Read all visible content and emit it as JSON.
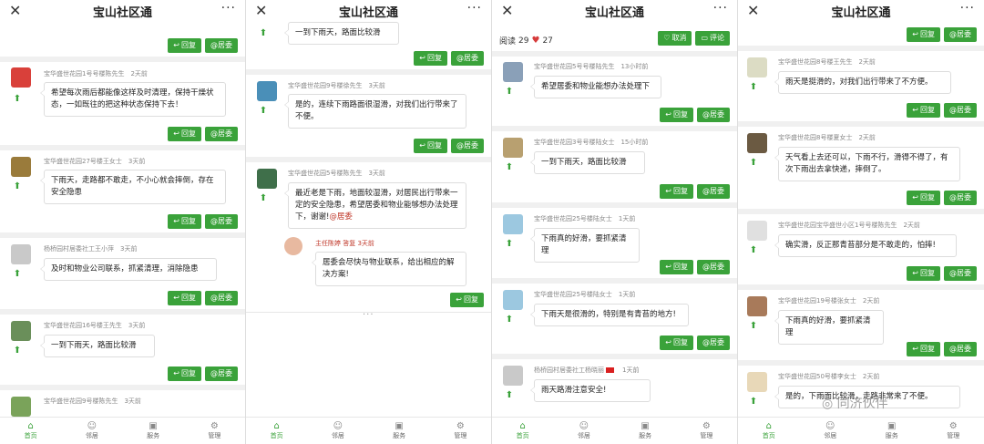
{
  "app": {
    "title": "宝山社区通",
    "close_icon": "✕",
    "more_icon": "···"
  },
  "actions": {
    "reply": "回复",
    "committee": "@居委",
    "cancel": "取消",
    "comment": "评论"
  },
  "stats": {
    "read_label": "阅读",
    "read_count": "29",
    "likes": "27"
  },
  "nav": {
    "home": "首页",
    "neighbors": "邻居",
    "service": "服务",
    "manage": "管理"
  },
  "panel1": {
    "c1": {
      "author": "宝华盛世花园1号号楼陈先生",
      "time": "2天前",
      "text": "希望每次雨后都能像这样及时清理，保持干燥状态，一如既往的把这种状态保持下去！"
    },
    "c2": {
      "author": "宝华盛世花园27号楼王女士",
      "time": "3天前",
      "text": "下雨天，走路都不敢走，不小心就会摔倒，存在安全隐患"
    },
    "c3": {
      "author": "杨桥园村居委社工王小萍",
      "time": "3天前",
      "text": "及时和物业公司联系，抓紧清理，消除隐患"
    },
    "c4": {
      "author": "宝华盛世花园16号楼王先生",
      "time": "3天前",
      "text": "一到下雨天，路面比较滑"
    },
    "c5": {
      "author": "宝华盛世花园9号楼陈先生",
      "time": "3天前"
    }
  },
  "panel2": {
    "c0": {
      "text": "一到下雨天，路面比较滑"
    },
    "c1": {
      "author": "宝华盛世花园9号楼徐先生",
      "time": "3天前",
      "text": "是的，连续下雨路面很湿滑，对我们出行带来了不便。"
    },
    "c2": {
      "author": "宝华盛世花园5号楼陈先生",
      "time": "3天前",
      "text": "最近老是下雨，地面较湿滑，对居民出行带来一定的安全隐患，希望居委和物业能够想办法处理下，谢谢!",
      "mention": "@居委"
    },
    "reply": {
      "author": "主任陈婷 答复 3天前",
      "text": "居委会尽快与物业联系，给出相应的解决方案!"
    }
  },
  "panel3": {
    "c1": {
      "author": "宝华盛世花园5号号楼陆先生",
      "time": "13小时前",
      "text": "希望居委和物业能想办法处理下"
    },
    "c2": {
      "author": "宝华盛世花园3号号楼陆女士",
      "time": "15小时前",
      "text": "一到下雨天，路面比较滑"
    },
    "c3": {
      "author": "宝华盛世花园25号楼陆女士",
      "time": "1天前",
      "text": "下雨真的好滑，要抓紧清理"
    },
    "c4": {
      "author": "宝华盛世花园25号楼陆女士",
      "time": "1天前",
      "text": "下雨天是很滑的，特别是有青苔的地方!"
    },
    "c5": {
      "author": "杨桥园村居委社工杨晓丽",
      "time": "1天前",
      "text": "雨天路滑注意安全!"
    }
  },
  "panel4": {
    "c1": {
      "author": "宝华盛世花园8号楼王先生",
      "time": "2天前",
      "text": "雨天是挺滑的，对我们出行带来了不方便。"
    },
    "c2": {
      "author": "宝华盛世花园8号楼夏女士",
      "time": "2天前",
      "text": "天气看上去还可以，下雨不行，滑得不得了，有次下雨出去拿快递，摔倒了。"
    },
    "c3": {
      "author": "宝华盛世花园宝华盛世小区1号号楼陈先生",
      "time": "2天前",
      "text": "确实滑，反正那青苔部分是不敢走的，怕摔!"
    },
    "c4": {
      "author": "宝华盛世花园19号楼张女士",
      "time": "2天前",
      "text": "下雨真的好滑，要抓紧清理"
    },
    "c5": {
      "author": "宝华盛世花园50号楼李女士",
      "time": "2天前",
      "text": "是的，下雨面比较滑，走路非常来了不便。"
    },
    "watermark": "同济伙伴"
  },
  "colors": {
    "accent": "#3aa23a",
    "heart": "#d63b3b",
    "mention": "#c0392b"
  }
}
